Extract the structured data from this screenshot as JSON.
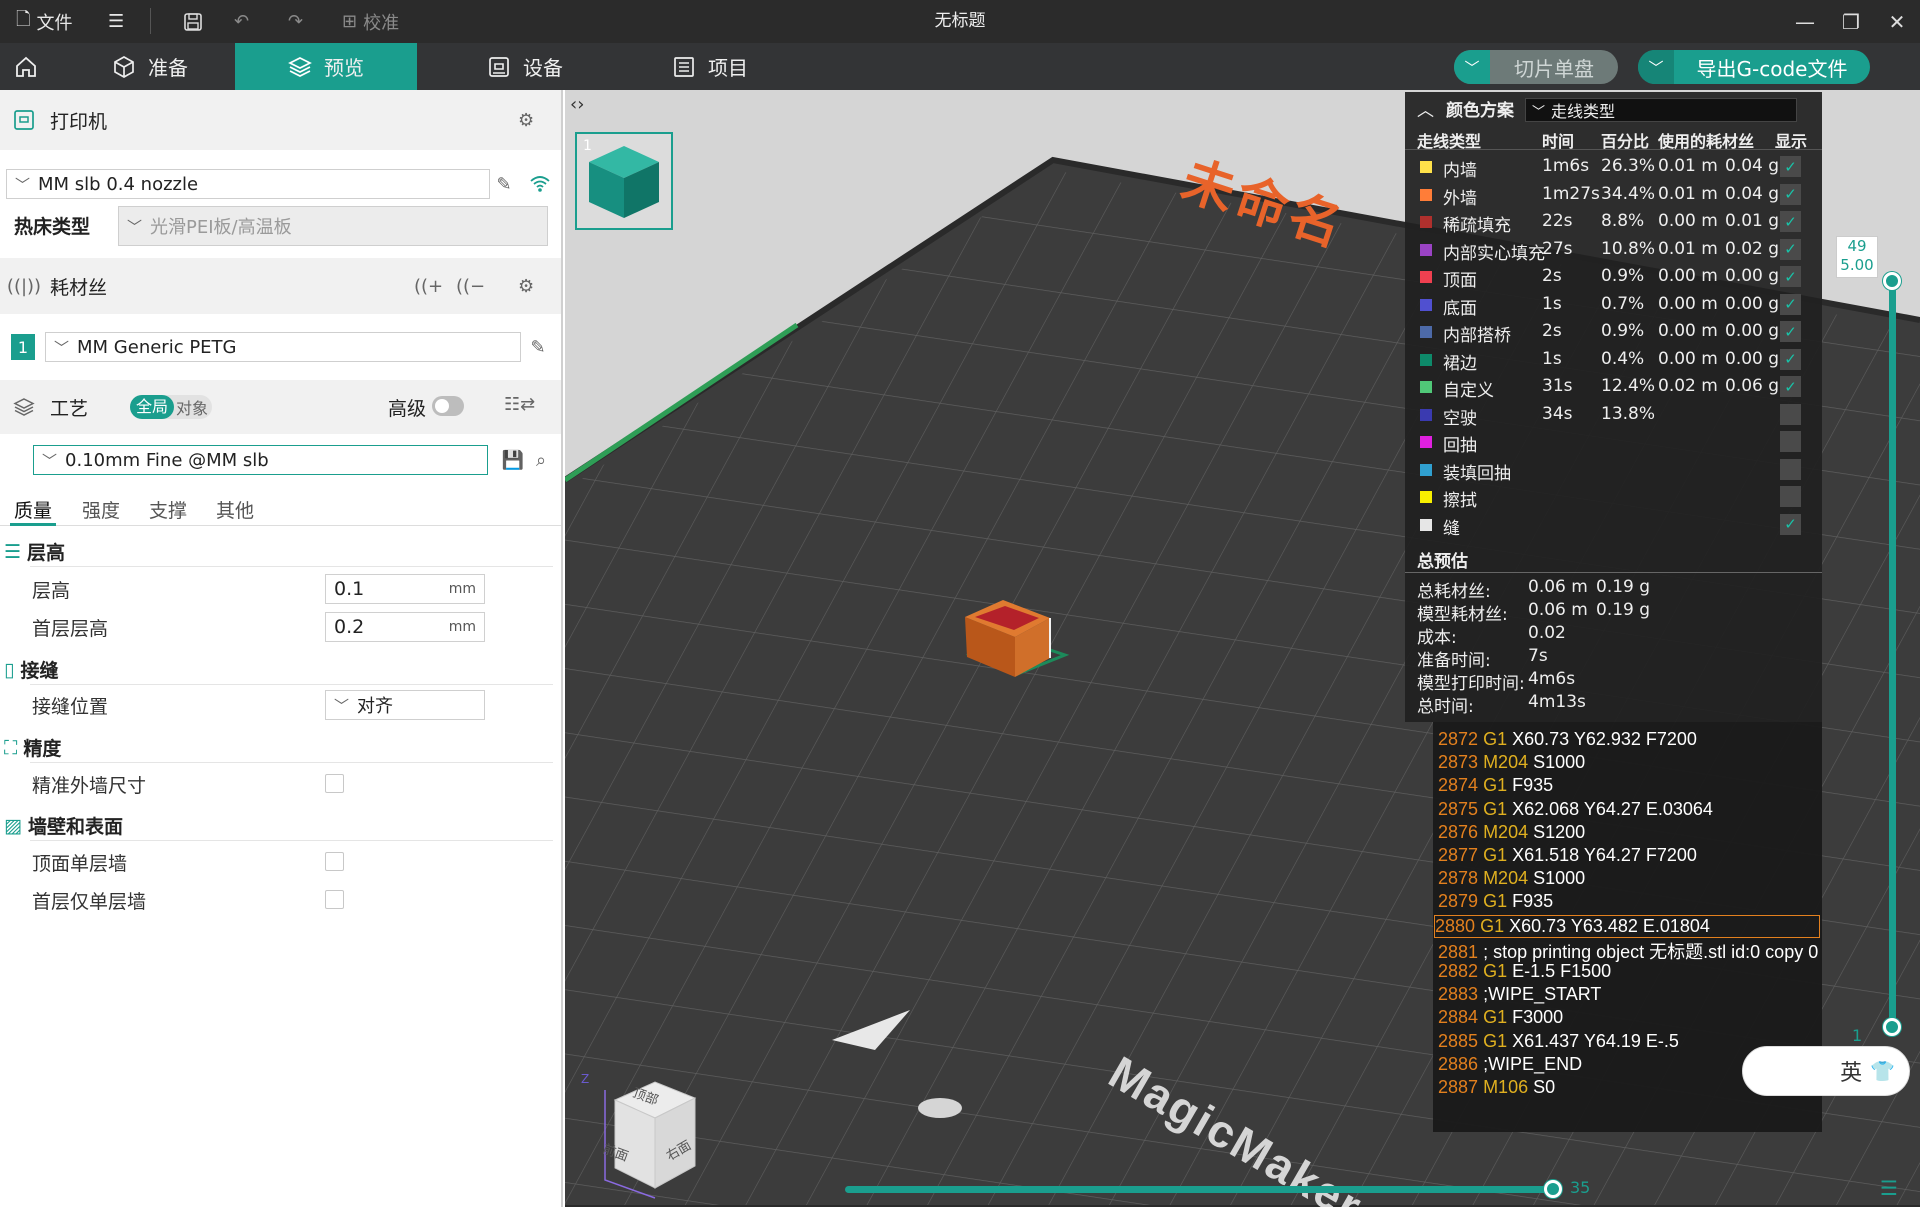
{
  "app": {
    "window_title": "无标题",
    "menu": {
      "file": "文件",
      "calibrate": "校准"
    }
  },
  "tabs": [
    {
      "label": "准备"
    },
    {
      "label": "预览"
    },
    {
      "label": "设备"
    },
    {
      "label": "项目"
    }
  ],
  "actions": {
    "slice_plate": "切片单盘",
    "export_gcode": "导出G-code文件"
  },
  "printer": {
    "section_title": "打印机",
    "selected": "MM slb 0.4 nozzle",
    "bed_type_label": "热床类型",
    "bed_type_value": "光滑PEI板/高温板"
  },
  "filament": {
    "section_title": "耗材丝",
    "slot_number": "1",
    "selected": "MM Generic PETG"
  },
  "process": {
    "section_title": "工艺",
    "toggle_global": "全局",
    "toggle_object": "对象",
    "advanced_label": "高级",
    "preset": "0.10mm Fine @MM slb",
    "subtabs": [
      "质量",
      "强度",
      "支撑",
      "其他"
    ]
  },
  "quality": {
    "groups": {
      "layer_height": "层高",
      "seam": "接缝",
      "precision": "精度",
      "walls_surfaces": "墙壁和表面"
    },
    "layer_height_label": "层高",
    "layer_height_value": "0.1",
    "first_layer_label": "首层层高",
    "first_layer_value": "0.2",
    "unit_mm": "mm",
    "seam_position_label": "接缝位置",
    "seam_position_value": "对齐",
    "precise_wall_label": "精准外墙尺寸",
    "top_single_wall_label": "顶面单层墙",
    "first_layer_single_wall_label": "首层仅单层墙"
  },
  "viewport": {
    "plate_name": "未命名",
    "brand": "MagicMaker",
    "view_cube": {
      "top": "顶部",
      "front": "前面",
      "right": "右面",
      "axis_z": "Z"
    },
    "plate_thumb_number": "1",
    "layer_top": "49",
    "layer_height_readout": "5.00",
    "layer_bottom": "1",
    "move_slider_value": "35",
    "ime": "英"
  },
  "legend": {
    "title": "颜色方案",
    "scheme": "走线类型",
    "columns": [
      "走线类型",
      "时间",
      "百分比",
      "使用的耗材丝",
      "显示"
    ],
    "rows": [
      {
        "name": "内墙",
        "time": "1m6s",
        "pct": "26.3%",
        "len": "0.01 m",
        "weight": "0.04 g",
        "color": "#ffe24a",
        "shown": true
      },
      {
        "name": "外墙",
        "time": "1m27s",
        "pct": "34.4%",
        "len": "0.01 m",
        "weight": "0.04 g",
        "color": "#ff7d38",
        "shown": true
      },
      {
        "name": "稀疏填充",
        "time": "22s",
        "pct": "8.8%",
        "len": "0.00 m",
        "weight": "0.01 g",
        "color": "#b0302d",
        "shown": true
      },
      {
        "name": "内部实心填充",
        "time": "27s",
        "pct": "10.8%",
        "len": "0.01 m",
        "weight": "0.02 g",
        "color": "#9a43c4",
        "shown": true
      },
      {
        "name": "顶面",
        "time": "2s",
        "pct": "0.9%",
        "len": "0.00 m",
        "weight": "0.00 g",
        "color": "#f04050",
        "shown": true
      },
      {
        "name": "底面",
        "time": "1s",
        "pct": "0.7%",
        "len": "0.00 m",
        "weight": "0.00 g",
        "color": "#5050d0",
        "shown": true
      },
      {
        "name": "内部搭桥",
        "time": "2s",
        "pct": "0.9%",
        "len": "0.00 m",
        "weight": "0.00 g",
        "color": "#4d6aa8",
        "shown": true
      },
      {
        "name": "裙边",
        "time": "1s",
        "pct": "0.4%",
        "len": "0.00 m",
        "weight": "0.00 g",
        "color": "#0e8a6a",
        "shown": true
      },
      {
        "name": "自定义",
        "time": "31s",
        "pct": "12.4%",
        "len": "0.02 m",
        "weight": "0.06 g",
        "color": "#50c878",
        "shown": true
      },
      {
        "name": "空驶",
        "time": "34s",
        "pct": "13.8%",
        "len": "",
        "weight": "",
        "color": "#3a3ab0",
        "shown": false
      },
      {
        "name": "回抽",
        "time": "",
        "pct": "",
        "len": "",
        "weight": "",
        "color": "#e020e0",
        "shown": false
      },
      {
        "name": "装填回抽",
        "time": "",
        "pct": "",
        "len": "",
        "weight": "",
        "color": "#30a0d0",
        "shown": false
      },
      {
        "name": "擦拭",
        "time": "",
        "pct": "",
        "len": "",
        "weight": "",
        "color": "#f8f000",
        "shown": false
      },
      {
        "name": "缝",
        "time": "",
        "pct": "",
        "len": "",
        "weight": "",
        "color": "#e6e6e6",
        "shown": true
      }
    ],
    "summary_title": "总预估",
    "summary": [
      {
        "label": "总耗材丝:",
        "v1": "0.06 m",
        "v2": "0.19 g"
      },
      {
        "label": "模型耗材丝:",
        "v1": "0.06 m",
        "v2": "0.19 g"
      },
      {
        "label": "成本:",
        "v1": "0.02",
        "v2": ""
      },
      {
        "label": "准备时间:",
        "v1": "7s",
        "v2": ""
      },
      {
        "label": "模型打印时间:",
        "v1": "4m6s",
        "v2": ""
      },
      {
        "label": "总时间:",
        "v1": "4m13s",
        "v2": ""
      }
    ]
  },
  "gcode": [
    {
      "num": "2872",
      "cmd": "G1",
      "args": "X60.73 Y62.932 F7200"
    },
    {
      "num": "2873",
      "cmd": "M204",
      "args": "S1000"
    },
    {
      "num": "2874",
      "cmd": "G1",
      "args": "F935"
    },
    {
      "num": "2875",
      "cmd": "G1",
      "args": "X62.068 Y64.27 E.03064"
    },
    {
      "num": "2876",
      "cmd": "M204",
      "args": "S1200"
    },
    {
      "num": "2877",
      "cmd": "G1",
      "args": "X61.518 Y64.27 F7200"
    },
    {
      "num": "2878",
      "cmd": "M204",
      "args": "S1000"
    },
    {
      "num": "2879",
      "cmd": "G1",
      "args": "F935"
    },
    {
      "num": "2880",
      "cmd": "G1",
      "args": "X60.73 Y63.482 E.01804",
      "current": true
    },
    {
      "num": "2881",
      "cmd": "",
      "args": "; stop printing object 无标题.stl id:0 copy 0"
    },
    {
      "num": "2882",
      "cmd": "G1",
      "args": "E-1.5 F1500"
    },
    {
      "num": "2883",
      "cmd": "",
      "args": ";WIPE_START"
    },
    {
      "num": "2884",
      "cmd": "G1",
      "args": "F3000"
    },
    {
      "num": "2885",
      "cmd": "G1",
      "args": "X61.437 Y64.19 E-.5"
    },
    {
      "num": "2886",
      "cmd": "",
      "args": ";WIPE_END"
    },
    {
      "num": "2887",
      "cmd": "M106",
      "args": "S0"
    }
  ],
  "colors": {
    "accent": "#1a9e8e",
    "gcode_number": "#e3801e",
    "gcode_cmd": "#e0b020"
  }
}
